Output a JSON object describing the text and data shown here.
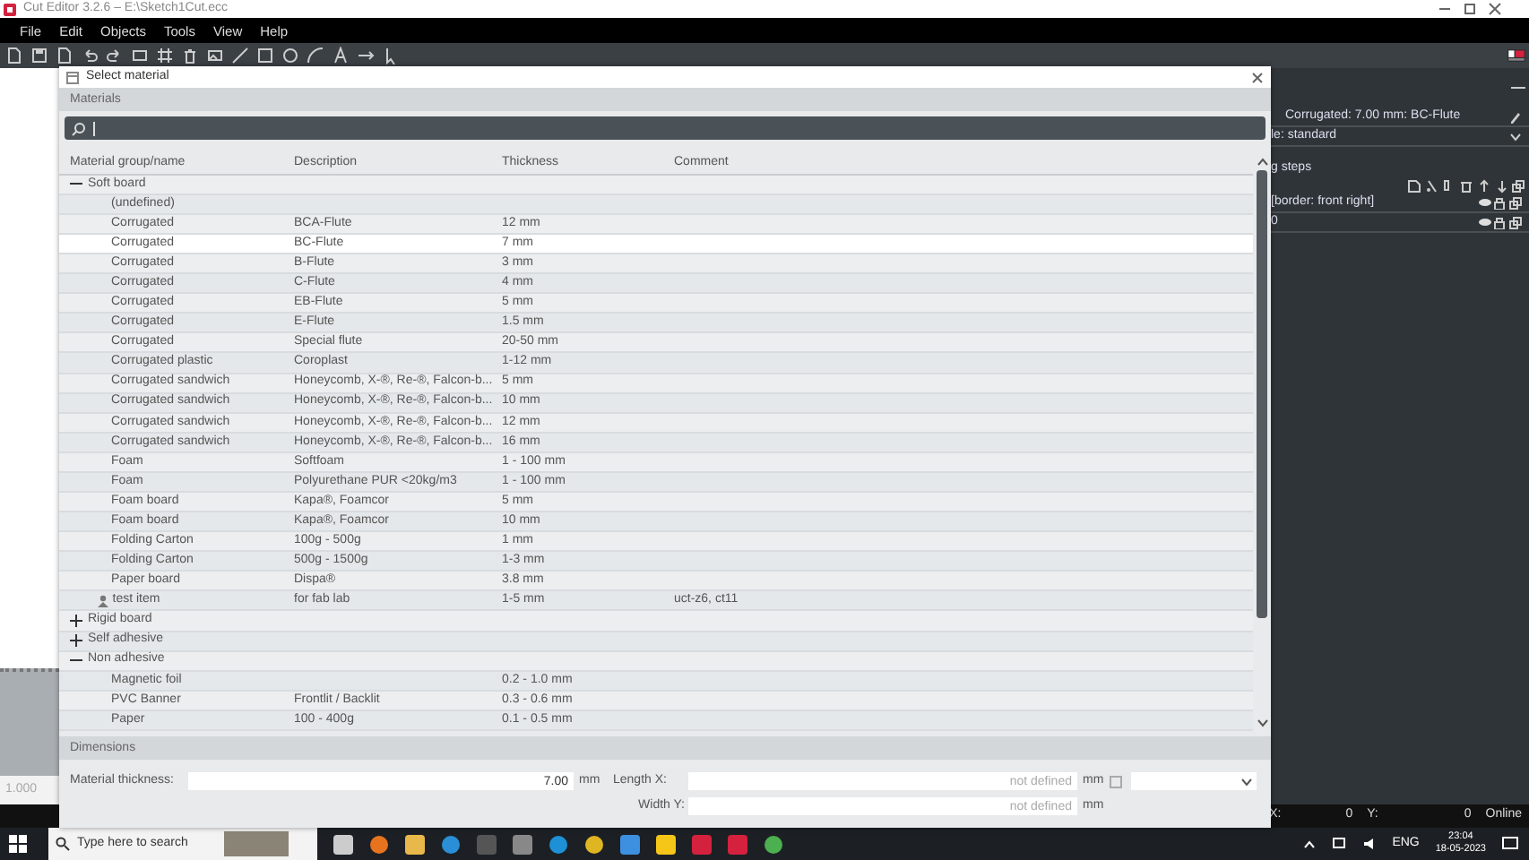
{
  "app": {
    "title": "Cut Editor 3.2.6  –  E:\\Sketch1Cut.ecc",
    "menu": [
      "File",
      "Edit",
      "Objects",
      "Tools",
      "View",
      "Help"
    ],
    "ruler_value": "1.000",
    "panel": {
      "material": "Corrugated: 7.00 mm: BC-Flute",
      "style": "le: standard",
      "steps_title": "g steps",
      "steps": [
        {
          "label": "[border: front right]"
        },
        {
          "label": "0"
        }
      ]
    },
    "status_bar": {
      "x_label": "X:",
      "x_value": "0",
      "y_label": "Y:",
      "y_value": "0",
      "connection": "Online"
    }
  },
  "dialog": {
    "title": "Select material",
    "materials_heading": "Materials",
    "columns": [
      "Material group/name",
      "Description",
      "Thickness",
      "Comment"
    ],
    "groups": [
      {
        "name": "Soft board",
        "expanded": true,
        "children": [
          {
            "kind": "material",
            "name": "(undefined)",
            "selected": false
          },
          {
            "kind": "material",
            "name": "Corrugated",
            "description": "BCA-Flute",
            "thickness": "12 mm",
            "selected": false
          },
          {
            "kind": "material",
            "name": "Corrugated",
            "description": "BC-Flute",
            "thickness": "7 mm",
            "selected": true
          },
          {
            "kind": "material",
            "name": "Corrugated",
            "description": "B-Flute",
            "thickness": "3 mm",
            "selected": false
          },
          {
            "kind": "material",
            "name": "Corrugated",
            "description": "C-Flute",
            "thickness": "4 mm",
            "selected": false
          },
          {
            "kind": "material",
            "name": "Corrugated",
            "description": "EB-Flute",
            "thickness": "5 mm",
            "selected": false
          },
          {
            "kind": "material",
            "name": "Corrugated",
            "description": "E-Flute",
            "thickness": "1.5 mm",
            "selected": false
          },
          {
            "kind": "material",
            "name": "Corrugated",
            "description": "Special flute",
            "thickness": "20-50 mm",
            "selected": false
          },
          {
            "kind": "material",
            "name": "Corrugated plastic",
            "description": "Coroplast",
            "thickness": "1-12 mm",
            "selected": false
          },
          {
            "kind": "material",
            "name": "Corrugated sandwich",
            "description": "Honeycomb, X-®, Re-®, Falcon-b...",
            "thickness": "5 mm",
            "selected": false
          },
          {
            "kind": "material",
            "name": "Corrugated sandwich",
            "description": "Honeycomb, X-®, Re-®, Falcon-b...",
            "thickness": "10 mm",
            "selected": false
          },
          {
            "kind": "material",
            "name": "Corrugated sandwich",
            "description": "Honeycomb, X-®, Re-®, Falcon-b...",
            "thickness": "12 mm",
            "selected": false
          },
          {
            "kind": "material",
            "name": "Corrugated sandwich",
            "description": "Honeycomb, X-®, Re-®, Falcon-b...",
            "thickness": "16 mm",
            "selected": false
          },
          {
            "kind": "material",
            "name": "Foam",
            "description": "Softfoam",
            "thickness": "1 - 100 mm",
            "selected": false
          },
          {
            "kind": "material",
            "name": "Foam",
            "description": "Polyurethane PUR <20kg/m3",
            "thickness": "1 - 100 mm",
            "selected": false
          },
          {
            "kind": "material",
            "name": "Foam board",
            "description": "Kapa®, Foamcor",
            "thickness": "5 mm",
            "selected": false
          },
          {
            "kind": "material",
            "name": "Foam board",
            "description": "Kapa®, Foamcor",
            "thickness": "10 mm",
            "selected": false
          },
          {
            "kind": "material",
            "name": "Folding Carton",
            "description": "100g - 500g",
            "thickness": "1 mm",
            "selected": false
          },
          {
            "kind": "material",
            "name": "Folding Carton",
            "description": "500g - 1500g",
            "thickness": "1-3 mm",
            "selected": false
          },
          {
            "kind": "material",
            "name": "Paper board",
            "description": "Dispa®",
            "thickness": "3.8 mm",
            "selected": false
          },
          {
            "kind": "custom",
            "name": "test item",
            "description": "for fab lab",
            "thickness": "1-5 mm",
            "comment": "uct-z6, ct11",
            "selected": false
          }
        ]
      },
      {
        "name": "Rigid board",
        "expanded": false
      },
      {
        "name": "Self adhesive",
        "expanded": false
      },
      {
        "name": "Non adhesive",
        "expanded": true,
        "children": [
          {
            "kind": "material",
            "name": "Magnetic foil",
            "thickness": "0.2 - 1.0 mm",
            "selected": false
          },
          {
            "kind": "material",
            "name": "PVC Banner",
            "description": "Frontlit / Backlit",
            "thickness": "0.3 - 0.6 mm",
            "selected": false
          },
          {
            "kind": "material",
            "name": "Paper",
            "description": "100 - 400g",
            "thickness": "0.1 - 0.5 mm",
            "selected": false
          }
        ]
      }
    ],
    "dimensions_heading": "Dimensions",
    "fields": [
      {
        "label": "Material thickness:",
        "value": "7.00",
        "unit": "mm"
      },
      {
        "label": "Length X:",
        "placeholder": "not defined",
        "unit": "mm"
      },
      {
        "label": "Width Y:",
        "placeholder": "not defined",
        "unit": "mm"
      }
    ]
  },
  "taskbar": {
    "search_placeholder": "Type here to search",
    "language": "ENG",
    "time": "23:04",
    "date": "18-05-2023"
  }
}
